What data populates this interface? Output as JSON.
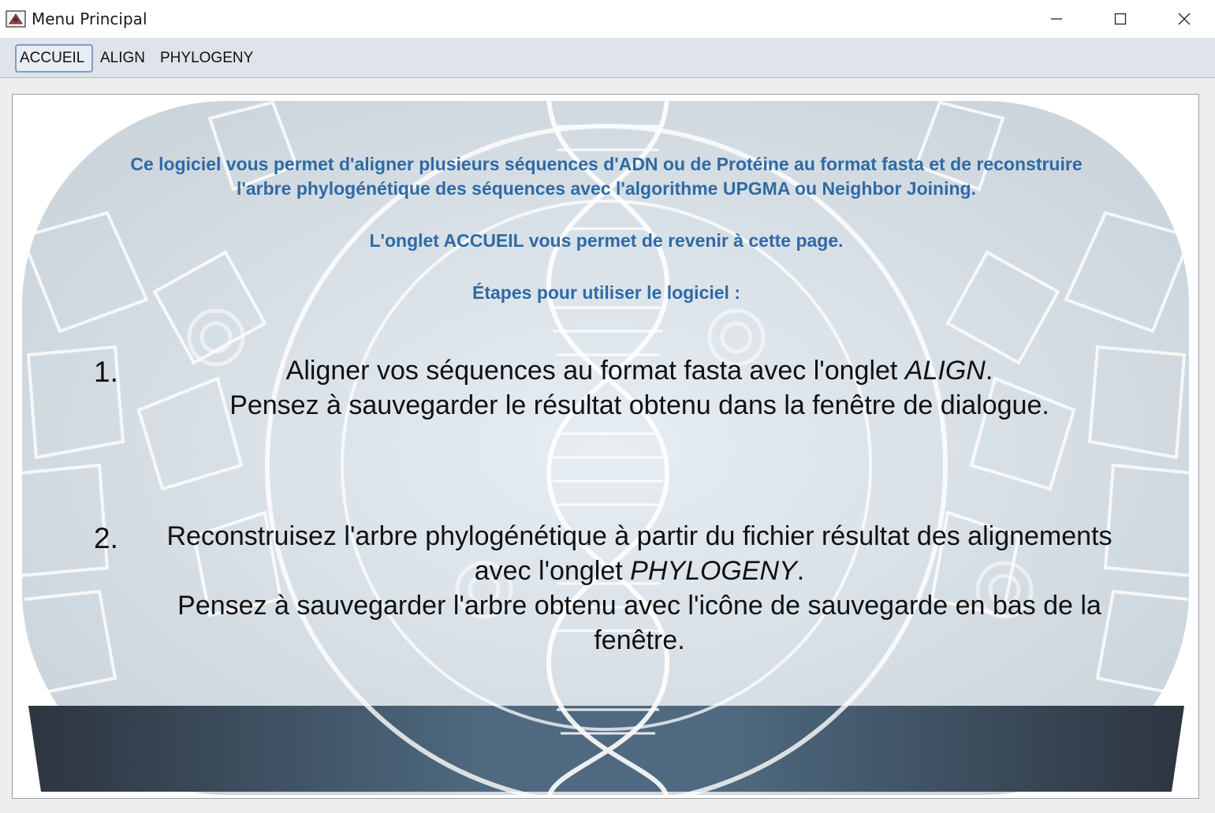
{
  "window": {
    "title": "Menu Principal",
    "controls": {
      "minimize": "—",
      "maximize": "☐",
      "close": "✕"
    }
  },
  "tabs": [
    {
      "label": "ACCUEIL",
      "selected": true
    },
    {
      "label": "ALIGN",
      "selected": false
    },
    {
      "label": "PHYLOGENY",
      "selected": false
    }
  ],
  "content": {
    "intro_line1": "Ce logiciel vous permet d'aligner plusieurs séquences d'ADN ou de Protéine au format fasta et de reconstruire",
    "intro_line2": "l'arbre phylogénétique des séquences avec l'algorithme UPGMA ou Neighbor Joining.",
    "accueil_note": "L'onglet ACCUEIL vous permet de revenir à cette page.",
    "steps_heading": "Étapes pour utiliser le logiciel :",
    "step1": {
      "number": "1.",
      "line1_pre": "Aligner vos séquences au format fasta avec l'onglet ",
      "line1_em": "ALIGN",
      "line1_post": ".",
      "line2": "Pensez à sauvegarder le résultat obtenu dans la fenêtre de dialogue."
    },
    "step2": {
      "number": "2.",
      "line1": "Reconstruisez l'arbre phylogénétique à partir du fichier résultat des alignements",
      "line2_pre": "avec l'onglet ",
      "line2_em": "PHYLOGENY",
      "line2_post": ".",
      "line3": "Pensez à sauvegarder l'arbre obtenu avec l'icône de sauvegarde en bas de la",
      "line4": "fenêtre."
    }
  },
  "colors": {
    "intro_text": "#2f6aa4",
    "step_text": "#111111",
    "tab_selected_border": "#7d9fc9",
    "menubar_bg": "#dfe3ea"
  }
}
